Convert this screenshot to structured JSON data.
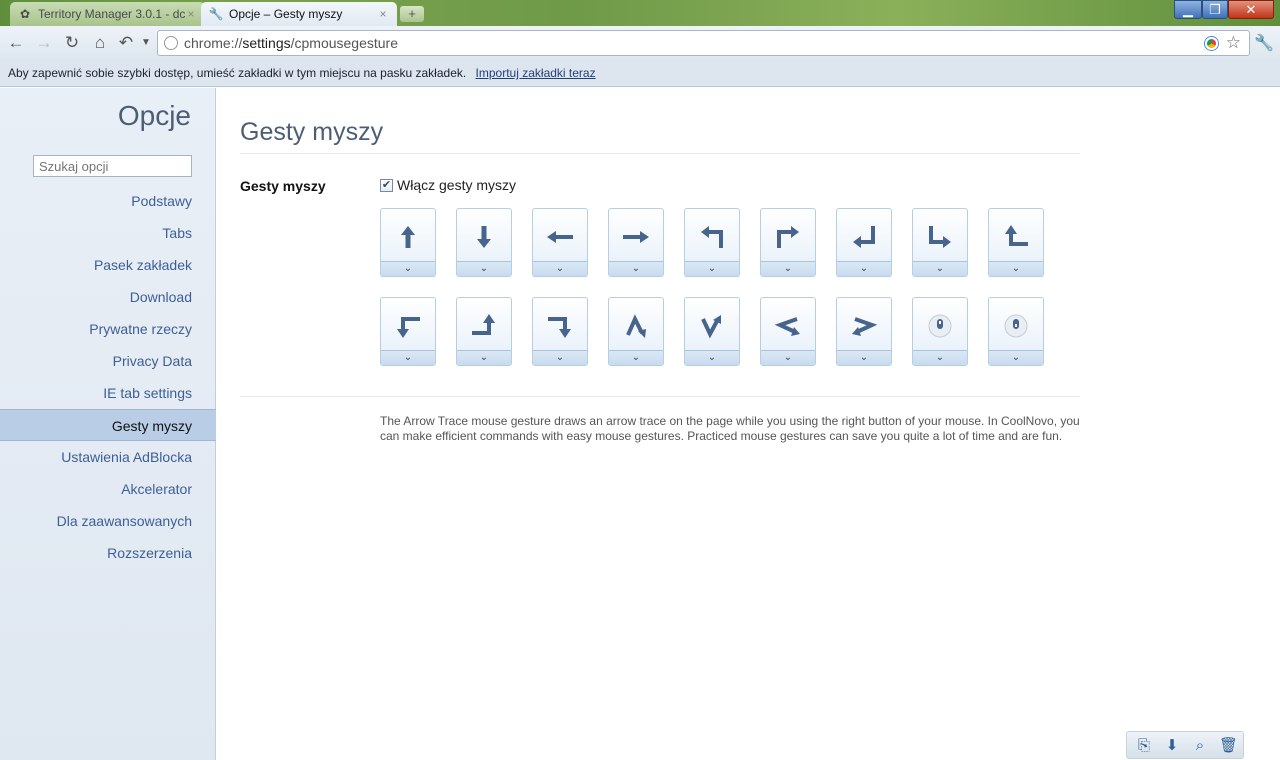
{
  "browser": {
    "tabs": [
      {
        "title": "Territory Manager 3.0.1 - dc",
        "close": "×"
      },
      {
        "title": "Opcje – Gesty myszy",
        "close": "×"
      }
    ],
    "new_tab": "+",
    "window_buttons": {
      "minimize": "▁",
      "maximize": "❐",
      "close": "✕"
    },
    "url_prefix": "chrome://",
    "url_host": "settings",
    "url_path": "/cpmousegesture"
  },
  "bookmarks_bar": {
    "message": "Aby zapewnić sobie szybki dostęp, umieść zakładki w tym miejscu na pasku zakładek.",
    "link": "Importuj zakładki teraz"
  },
  "sidebar": {
    "title": "Opcje",
    "search_placeholder": "Szukaj opcji",
    "items": [
      {
        "label": "Podstawy"
      },
      {
        "label": "Tabs"
      },
      {
        "label": "Pasek zakładek"
      },
      {
        "label": "Download"
      },
      {
        "label": "Prywatne rzeczy"
      },
      {
        "label": "Privacy Data"
      },
      {
        "label": "IE tab settings"
      },
      {
        "label": "Gesty myszy",
        "active": true
      },
      {
        "label": "Ustawienia AdBlocka"
      },
      {
        "label": "Akcelerator"
      },
      {
        "label": "Dla zaawansowanych"
      },
      {
        "label": "Rozszerzenia"
      }
    ]
  },
  "main": {
    "title": "Gesty myszy",
    "section_label": "Gesty myszy",
    "enable_label": "Włącz gesty myszy",
    "enable_checked": true,
    "gestures_row1": [
      "arrow-up",
      "arrow-down",
      "arrow-left",
      "arrow-right",
      "up-left",
      "up-right",
      "down-left",
      "down-right",
      "left-up"
    ],
    "gestures_row2": [
      "down-left-turn",
      "right-up",
      "right-down",
      "up-down",
      "down-up",
      "left-right-left",
      "right-left-right",
      "mouse-wheel-up",
      "mouse-wheel-down"
    ],
    "description": "The Arrow Trace mouse gesture draws an arrow trace on the page while you using the right button of your mouse. In CoolNovo, you can make efficient commands with easy mouse gestures. Practiced mouse gestures can save you quite a lot of time and are fun."
  },
  "accent_color": "#3d5f96"
}
